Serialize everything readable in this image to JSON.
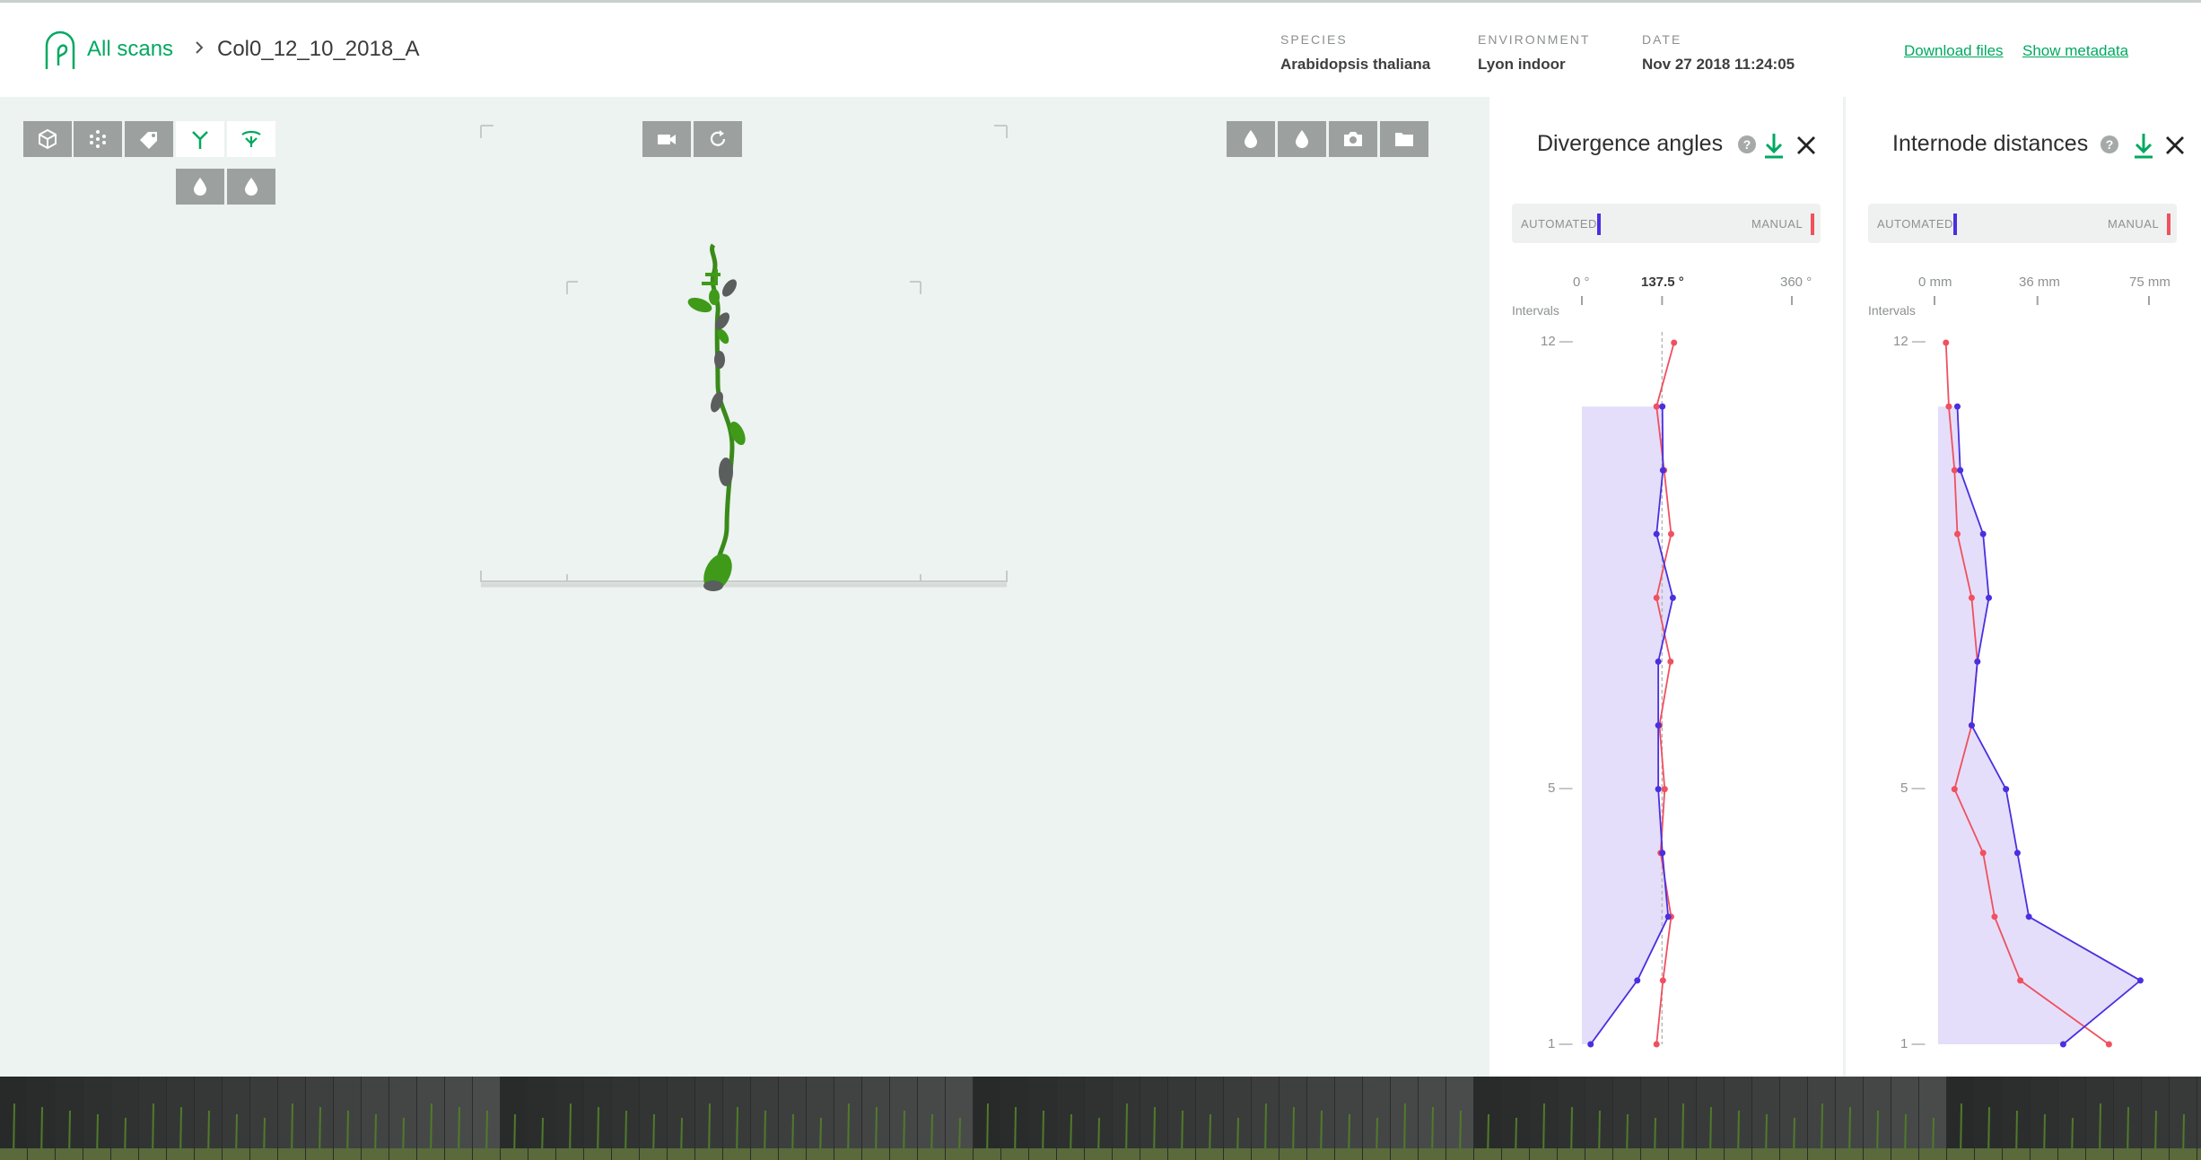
{
  "header": {
    "breadcrumb_root": "All scans",
    "breadcrumb_current": "Col0_12_10_2018_A",
    "meta": [
      {
        "label": "SPECIES",
        "value": "Arabidopsis thaliana"
      },
      {
        "label": "ENVIRONMENT",
        "value": "Lyon indoor"
      },
      {
        "label": "DATE",
        "value": "Nov 27 2018 11:24:05"
      }
    ],
    "links": {
      "download": "Download files",
      "metadata": "Show metadata"
    }
  },
  "viewer": {
    "toolbar_left": [
      "mesh-icon",
      "point-cloud-icon",
      "tag-icon",
      "skeleton-icon",
      "organs-icon"
    ],
    "toolbar_left_sub": [
      "droplet-icon",
      "droplet-icon"
    ],
    "toolbar_center": [
      "camera-icon",
      "refresh-icon"
    ],
    "toolbar_right": [
      "droplet-icon",
      "droplet-icon",
      "snapshot-icon",
      "folder-icon"
    ],
    "help_glyph": "?"
  },
  "panels": {
    "divergence": {
      "title": "Divergence angles",
      "help": "?",
      "legend_automated": "AUTOMATED",
      "legend_manual": "MANUAL",
      "tick_min": "0 °",
      "tick_mid": "137.5 °",
      "tick_max": "360 °",
      "intervals_label": "Intervals",
      "y_top": "12 —",
      "y_mid": "5 —",
      "y_bottom": "1 —"
    },
    "internode": {
      "title": "Internode distances",
      "help": "?",
      "legend_automated": "AUTOMATED",
      "legend_manual": "MANUAL",
      "tick_min": "0 mm",
      "tick_mid": "36 mm",
      "tick_max": "75 mm",
      "intervals_label": "Intervals",
      "y_top": "12 —",
      "y_mid": "5 —",
      "y_bottom": "1 —"
    }
  },
  "colors": {
    "accent": "#00a960",
    "automated": "#4a2fe0",
    "manual": "#f0505f",
    "band": "#e4defa"
  },
  "chart_data": [
    {
      "type": "line",
      "title": "Divergence angles",
      "xlabel": "",
      "ylabel": "Intervals",
      "xlim": [
        0,
        360
      ],
      "ylim": [
        1,
        12
      ],
      "reference": 137.5,
      "series": [
        {
          "name": "AUTOMATED",
          "x": [
            1,
            2,
            3,
            4,
            5,
            6,
            7,
            8,
            9,
            10,
            11
          ],
          "values": [
            15,
            95,
            148,
            138,
            131,
            131,
            131,
            156,
            128,
            139,
            138
          ]
        },
        {
          "name": "MANUAL",
          "x": [
            1,
            2,
            3,
            4,
            5,
            6,
            7,
            8,
            9,
            10,
            11,
            12
          ],
          "values": [
            128,
            139,
            153,
            135,
            142,
            133,
            152,
            128,
            153,
            141,
            128,
            158
          ]
        }
      ]
    },
    {
      "type": "line",
      "title": "Internode distances",
      "xlabel": "",
      "ylabel": "Intervals",
      "xlim": [
        0,
        75
      ],
      "ylim": [
        1,
        12
      ],
      "series": [
        {
          "name": "AUTOMATED",
          "x": [
            1,
            2,
            3,
            4,
            5,
            6,
            7,
            8,
            9,
            10,
            11
          ],
          "values": [
            45,
            72,
            33,
            29,
            25,
            13,
            15,
            19,
            17,
            9,
            8
          ]
        },
        {
          "name": "MANUAL",
          "x": [
            1,
            2,
            3,
            4,
            5,
            6,
            7,
            8,
            9,
            10,
            11,
            12
          ],
          "values": [
            61,
            30,
            21,
            17,
            7,
            13,
            15,
            13,
            8,
            7,
            5,
            4
          ]
        }
      ]
    }
  ]
}
